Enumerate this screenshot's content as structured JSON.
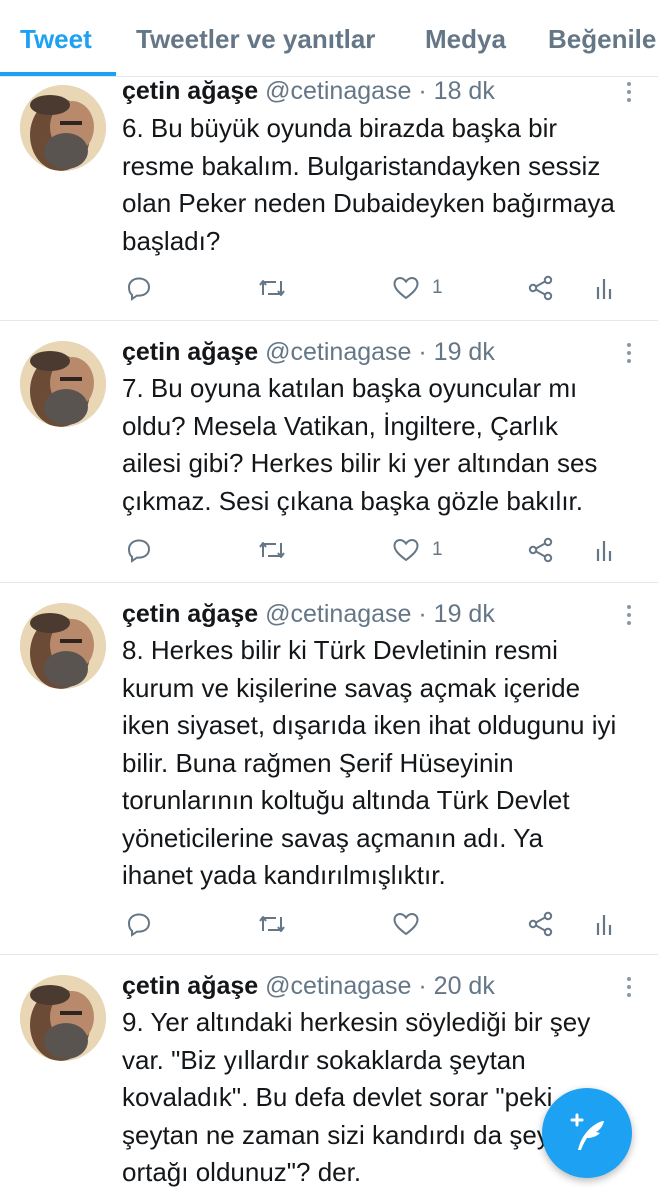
{
  "tabs": [
    {
      "label": "Tweet",
      "active": true
    },
    {
      "label": "Tweetler ve yanıtlar",
      "active": false
    },
    {
      "label": "Medya",
      "active": false
    },
    {
      "label": "Beğenile",
      "active": false
    }
  ],
  "tweets": [
    {
      "display_name": "çetin ağaşe",
      "handle": "@cetinagase",
      "time": "· 18 dk",
      "text": "6. Bu büyük oyunda birazda başka bir resme bakalım. Bulgaristandayken sessiz olan Peker neden Dubaideyken bağırmaya başladı?",
      "like_count": "1"
    },
    {
      "display_name": "çetin ağaşe",
      "handle": "@cetinagase",
      "time": "· 19 dk",
      "text": "7. Bu oyuna katılan başka oyuncular mı oldu? Mesela Vatikan, İngiltere, Çarlık ailesi gibi? Herkes bilir ki yer altından ses çıkmaz. Sesi çıkana başka gözle bakılır.",
      "like_count": "1"
    },
    {
      "display_name": "çetin ağaşe",
      "handle": "@cetinagase",
      "time": "· 19 dk",
      "text": "8. Herkes bilir ki Türk Devletinin resmi kurum ve kişilerine savaş açmak içeride iken siyaset, dışarıda iken ihat oldugunu iyi bilir. Buna rağmen Şerif Hüseyinin torunlarının koltuğu altında Türk Devlet yöneticilerine savaş açmanın adı. Ya ihanet yada kandırılmışlıktır.",
      "like_count": ""
    },
    {
      "display_name": "çetin ağaşe",
      "handle": "@cetinagase",
      "time": "· 20 dk",
      "text": "9. Yer altındaki herkesin söylediği bir şey var. \"Biz yıllardır sokaklarda şeytan kovaladık\". Bu defa devlet sorar \"peki şeytan ne zaman sizi kandırdı da şeytana ortağı oldunuz\"? der.",
      "like_count": ""
    }
  ],
  "colors": {
    "accent": "#1da1f2",
    "text": "#14171a",
    "secondary": "#657786",
    "divider": "#e1e8ed"
  },
  "icons": [
    "reply-icon",
    "retweet-icon",
    "like-icon",
    "share-icon",
    "analytics-icon",
    "more-icon",
    "compose-tweet-icon"
  ]
}
